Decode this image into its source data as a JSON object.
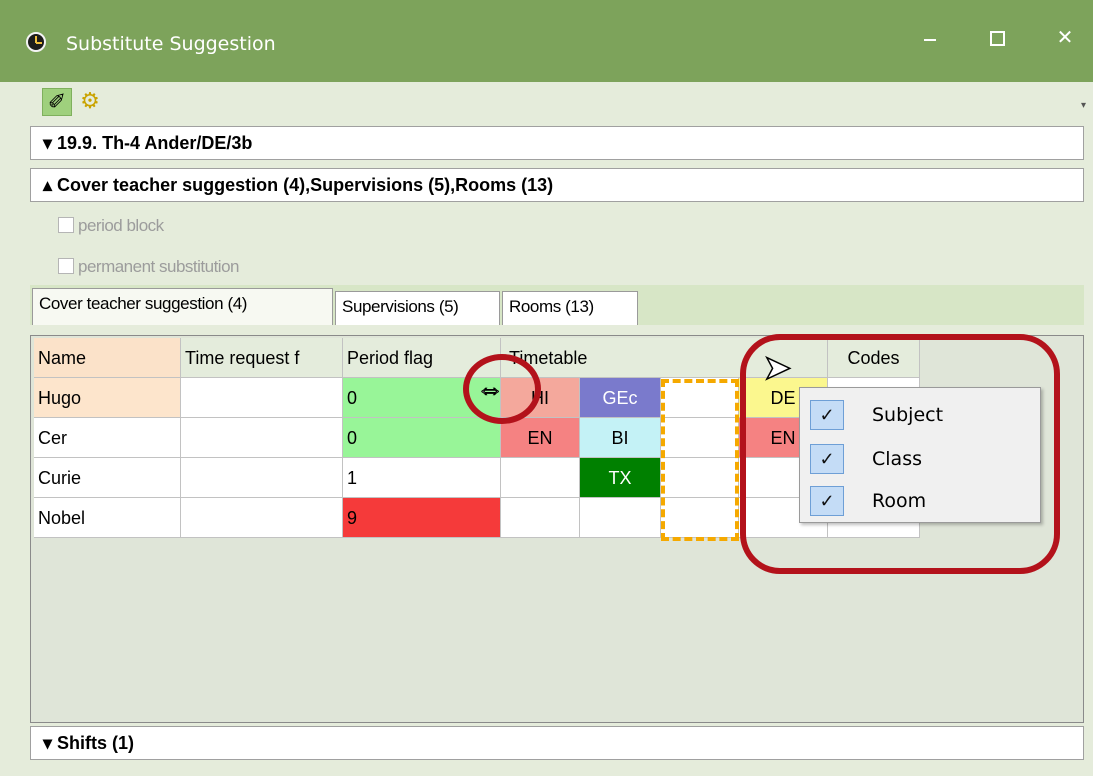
{
  "window": {
    "title": "Substitute Suggestion",
    "min_label": "",
    "max_label": "",
    "close_label": "✕"
  },
  "toolbar": {
    "edit_icon": "✐",
    "settings_icon": "⚙",
    "dropdown_glyph": "▾"
  },
  "sections": {
    "lesson": "▾ 19.9. Th-4 Ander/DE/3b",
    "suggestions": "▴ Cover teacher suggestion (4),Supervisions (5),Rooms (13)",
    "shifts": "▾ Shifts (1)"
  },
  "options": {
    "period_block": "period block",
    "permanent_substitution": "permanent substitution"
  },
  "tabs": [
    {
      "label": "Cover teacher suggestion (4)"
    },
    {
      "label": "Supervisions (5)"
    },
    {
      "label": "Rooms (13)"
    }
  ],
  "grid": {
    "headers": {
      "name": "Name",
      "time_request": "Time request f",
      "period_flag": "Period flag",
      "timetable": "Timetable",
      "codes": "Codes"
    },
    "rows": [
      {
        "name": "Hugo",
        "period_flag": "0",
        "tt1": "HI",
        "tt2": "GEc",
        "tt4": "DE"
      },
      {
        "name": "Cer",
        "period_flag": "0",
        "tt1": "EN",
        "tt2": "BI",
        "tt4": "EN"
      },
      {
        "name": "Curie",
        "period_flag": "1",
        "tt1": "",
        "tt2": "TX",
        "tt4": ""
      },
      {
        "name": "Nobel",
        "period_flag": "9",
        "tt1": "",
        "tt2": "",
        "tt4": ""
      }
    ]
  },
  "context_menu": {
    "items": [
      {
        "label": "Subject",
        "checked": true
      },
      {
        "label": "Class",
        "checked": true
      },
      {
        "label": "Room",
        "checked": true
      }
    ]
  },
  "colors": {
    "titlebar": "#7da35b",
    "annotation": "#b3121b",
    "period_flag_ok": "#98f598",
    "period_flag_alert": "#f53a3a",
    "tx_cell": "#008000",
    "gec_cell": "#7a7acc"
  }
}
